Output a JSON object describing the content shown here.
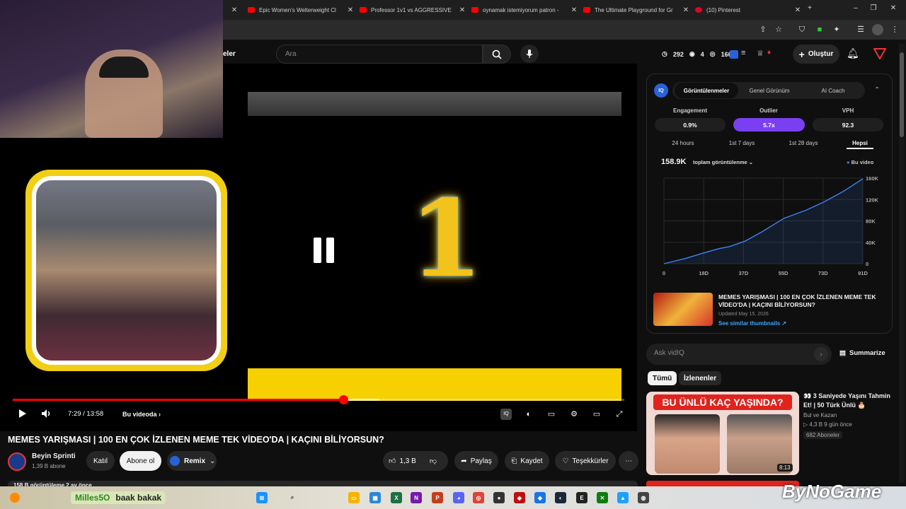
{
  "browser": {
    "tabs": [
      {
        "label": "Epic Women's Welterweight Cl",
        "icon": "youtube-icon"
      },
      {
        "label": "Professor 1v1 vs AGGRESSIVE (",
        "icon": "youtube-icon"
      },
      {
        "label": "oynamak istemiyorum patron -",
        "icon": "youtube-icon"
      },
      {
        "label": "The Ultimate Playground for Gr",
        "icon": "youtube-icon"
      },
      {
        "label": "(10) Pinterest",
        "icon": "pinterest-icon"
      }
    ],
    "new_tab": "+"
  },
  "header": {
    "nav_fragment": "eler",
    "search_placeholder": "Ara",
    "counters": {
      "views_a": "292",
      "views_b": "4",
      "views_c": "166"
    },
    "create_label": "Oluştur"
  },
  "video": {
    "big_number": "1",
    "time": "7:29 / 13:58",
    "chapter": "Bu videoda",
    "progress": 0.54,
    "buffered": 0.6
  },
  "details": {
    "title": "MEMES YARIŞMASI | 100 EN ÇOK İZLENEN MEME TEK VİDEO'DA | KAÇINI BİLİYORSUN?",
    "channel": "Beyin Sprinti",
    "subscribers": "1,39 B abone",
    "join": "Katıl",
    "subscribe": "Abone ol",
    "remix": "Remix",
    "likes": "1,3 B",
    "share": "Paylaş",
    "save": "Kaydet",
    "thanks": "Teşekkürler",
    "stats_line": "158 B görüntüleme  2 ay önce"
  },
  "vidiq": {
    "tabs": [
      "Görüntülenmeler",
      "Genel Görünüm",
      "AI Coach"
    ],
    "metrics": [
      {
        "label": "Engagement",
        "value": "0.9%"
      },
      {
        "label": "Outlier",
        "value": "5.7x"
      },
      {
        "label": "VPH",
        "value": "92.3"
      }
    ],
    "ranges": [
      "24 hours",
      "1st 7 days",
      "1st 28 days",
      "Hepsi"
    ],
    "total": "158.9K",
    "total_label": "toplam görüntülenme",
    "legend": "Bu video",
    "thumb_title": "MEMES YARIŞMASI | 100 EN ÇOK İZLENEN MEME TEK VİDEO'DA | KAÇINI BİLİYORSUN?",
    "updated": "Updated May 15, 2026",
    "similar": "See similar thumbnails ↗"
  },
  "chart_data": {
    "type": "line",
    "x_ticks": [
      "0",
      "18D",
      "37D",
      "55D",
      "73D",
      "91D"
    ],
    "y_ticks": [
      "0",
      "40K",
      "80K",
      "120K",
      "160K"
    ],
    "ylim": [
      0,
      160000
    ],
    "xlim": [
      0,
      91
    ],
    "series": [
      {
        "name": "Bu video",
        "x": [
          0,
          10,
          18,
          25,
          30,
          37,
          45,
          55,
          65,
          73,
          82,
          91
        ],
        "y": [
          0,
          10000,
          20000,
          28000,
          32000,
          42000,
          60000,
          85000,
          100000,
          115000,
          135000,
          158900
        ]
      }
    ]
  },
  "ask": {
    "placeholder": "Ask vidIQ",
    "summarize": "Summarize"
  },
  "filters": [
    "Tümü",
    "İzlenenler"
  ],
  "recommended": {
    "thumb_headline": "BU ÜNLÜ KAÇ YAŞINDA?",
    "duration": "8:13",
    "title": "👀 3 Saniyede Yaşını Tahmin Et! | 50 Türk Ünlü 🎂",
    "channel": "Bul ve Kazan",
    "meta": "▷ 4,3 B   9 gün önce",
    "badge": "682 Aboneler"
  },
  "overlay": {
    "chat_user": "Milles5O",
    "chat_text": "baak bakak",
    "watermark": "ByNoGame"
  }
}
